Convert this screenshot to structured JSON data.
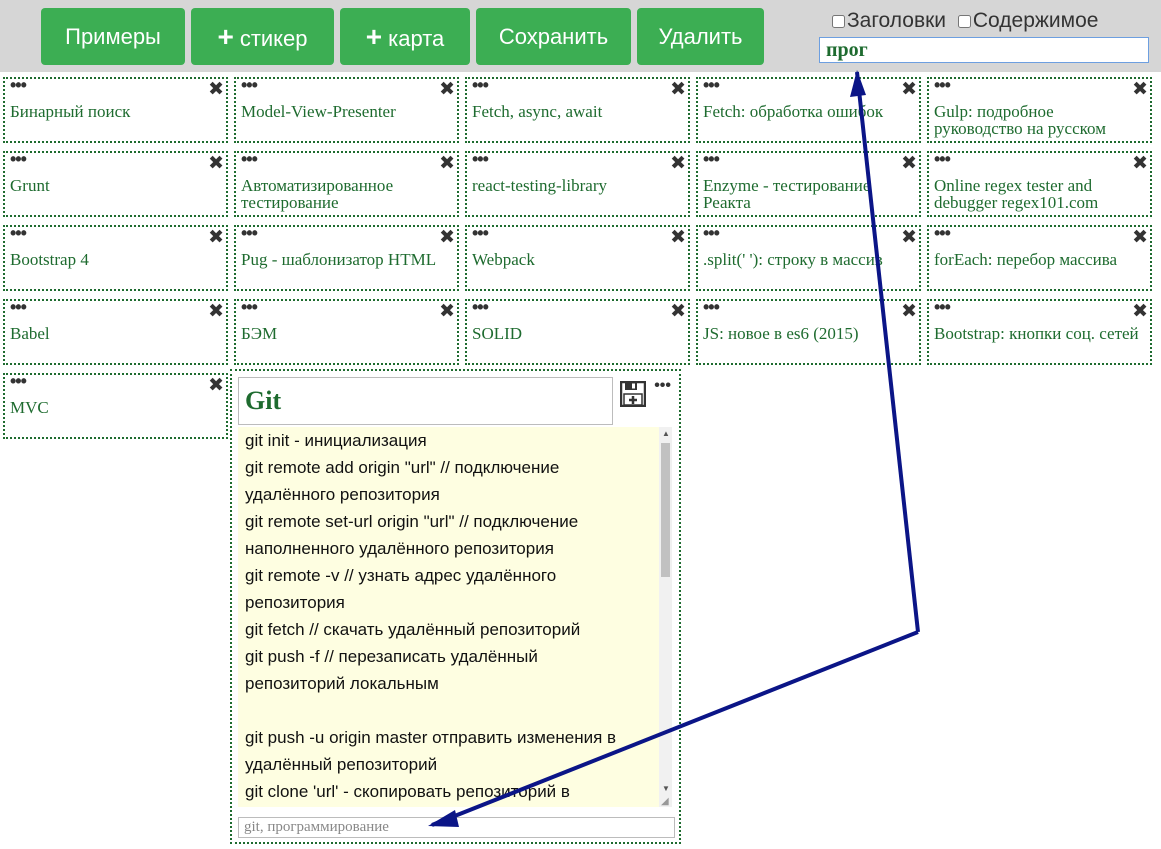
{
  "toolbar": {
    "examples_label": "Примеры",
    "add_sticker_plus": "+",
    "add_sticker_label": "стикер",
    "add_card_plus": "+",
    "add_card_label": "карта",
    "save_label": "Сохранить",
    "delete_label": "Удалить"
  },
  "filters": {
    "headers_label": "Заголовки",
    "content_label": "Содержимое",
    "search_value": "прог"
  },
  "icons": {
    "menu_dots": "•••",
    "close": "✖",
    "card_more": "•••",
    "save": "floppy-add-icon"
  },
  "stickers": [
    "Бинарный поиск",
    "Model-View-Presenter",
    "Fetch, async, await",
    "Fetch: обработка ошибок",
    "Gulp: подробное руководство на русском",
    "Grunt",
    "Автоматизированное тестирование",
    "react-testing-library",
    "Enzyme - тестирование Реакта",
    "Online regex tester and debugger regex101.com",
    "Bootstrap 4",
    "Pug - шаблонизатор HTML",
    "Webpack",
    ".split(' '): строку в массив",
    "forEach: перебор массива",
    "Babel",
    "БЭМ",
    "SOLID",
    "JS: новое в es6 (2015)",
    "Bootstrap: кнопки соц. сетей",
    "MVC"
  ],
  "card": {
    "title": "Git",
    "lines": [
      "git init - инициализация",
      "git remote add origin \"url\" // подключение",
      "удалённого репозитория",
      "git remote set-url origin \"url\" // подключение",
      "наполненного удалённого репозитория",
      "git remote -v // узнать адрес удалённого",
      "репозитория",
      "git fetch // скачать удалённый репозиторий",
      "git push -f // перезаписать удалённый",
      "репозиторий локальным",
      "",
      "git push -u origin master отправить изменения в",
      "удалённый репозиторий",
      "git clone 'url' - скопировать репозиторий в"
    ],
    "tags": "git, программирование"
  },
  "colors": {
    "button": "#3cae53",
    "accent_green": "#1e6b2f",
    "card_body": "#fefee1",
    "arrow": "#0b1587"
  }
}
